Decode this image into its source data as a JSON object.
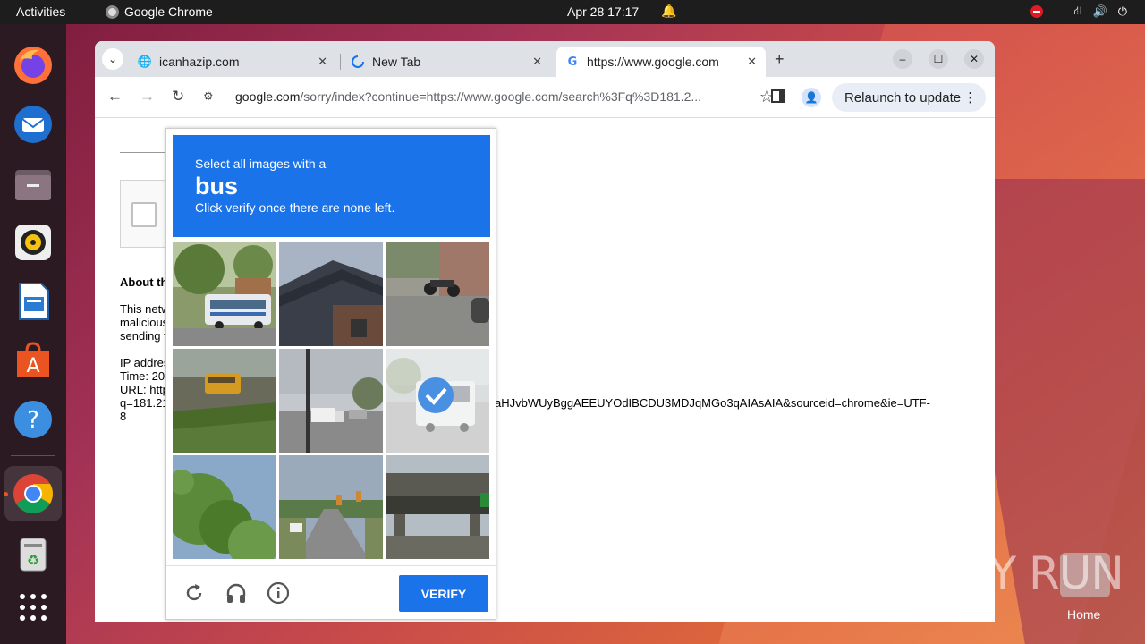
{
  "topbar": {
    "activities": "Activities",
    "app_name": "Google Chrome",
    "datetime": "Apr 28  17:17"
  },
  "dock": {
    "items": [
      "Firefox",
      "Thunderbird",
      "Files",
      "Rhythmbox",
      "LibreOffice Impress",
      "App Center",
      "Help",
      "Google Chrome",
      "Trash",
      "Show Apps"
    ]
  },
  "browser": {
    "tabs": [
      {
        "label": "icanhazip.com"
      },
      {
        "label": "New Tab"
      },
      {
        "label": "https://www.google.com"
      }
    ],
    "url_host": "google.com",
    "url_path": "/sorry/index?continue=https://www.google.com/search%3Fq%3D181.2...",
    "relaunch_label": "Relaunch to update"
  },
  "page": {
    "about_heading": "About th",
    "para1": [
      "This netw",
      "malicious",
      "sending t"
    ],
    "ip_label": "IP addres",
    "time_label": "Time: 20",
    "url_label": "URL: http",
    "url_q": "q=181.21",
    "url_tail": "aHJvbWUyBggAEEUYOdIBCDU3MDJqMGo3qAIAsAIA&sourceid=chrome&ie=UTF-",
    "url_end": "8"
  },
  "captcha": {
    "instruction": "Select all images with a",
    "target": "bus",
    "hint": "Click verify once there are none left.",
    "verify_label": "VERIFY",
    "tiles": [
      {
        "name": "bus-street",
        "selected": false
      },
      {
        "name": "house-roof",
        "selected": false
      },
      {
        "name": "motorcycle-road",
        "selected": false
      },
      {
        "name": "school-bus",
        "selected": false
      },
      {
        "name": "street-truck",
        "selected": false
      },
      {
        "name": "bus-road",
        "selected": true
      },
      {
        "name": "trees",
        "selected": false
      },
      {
        "name": "traffic-lights",
        "selected": false
      },
      {
        "name": "overpass",
        "selected": false
      }
    ]
  },
  "watermark": "ANY RUN",
  "home_label": "Home"
}
